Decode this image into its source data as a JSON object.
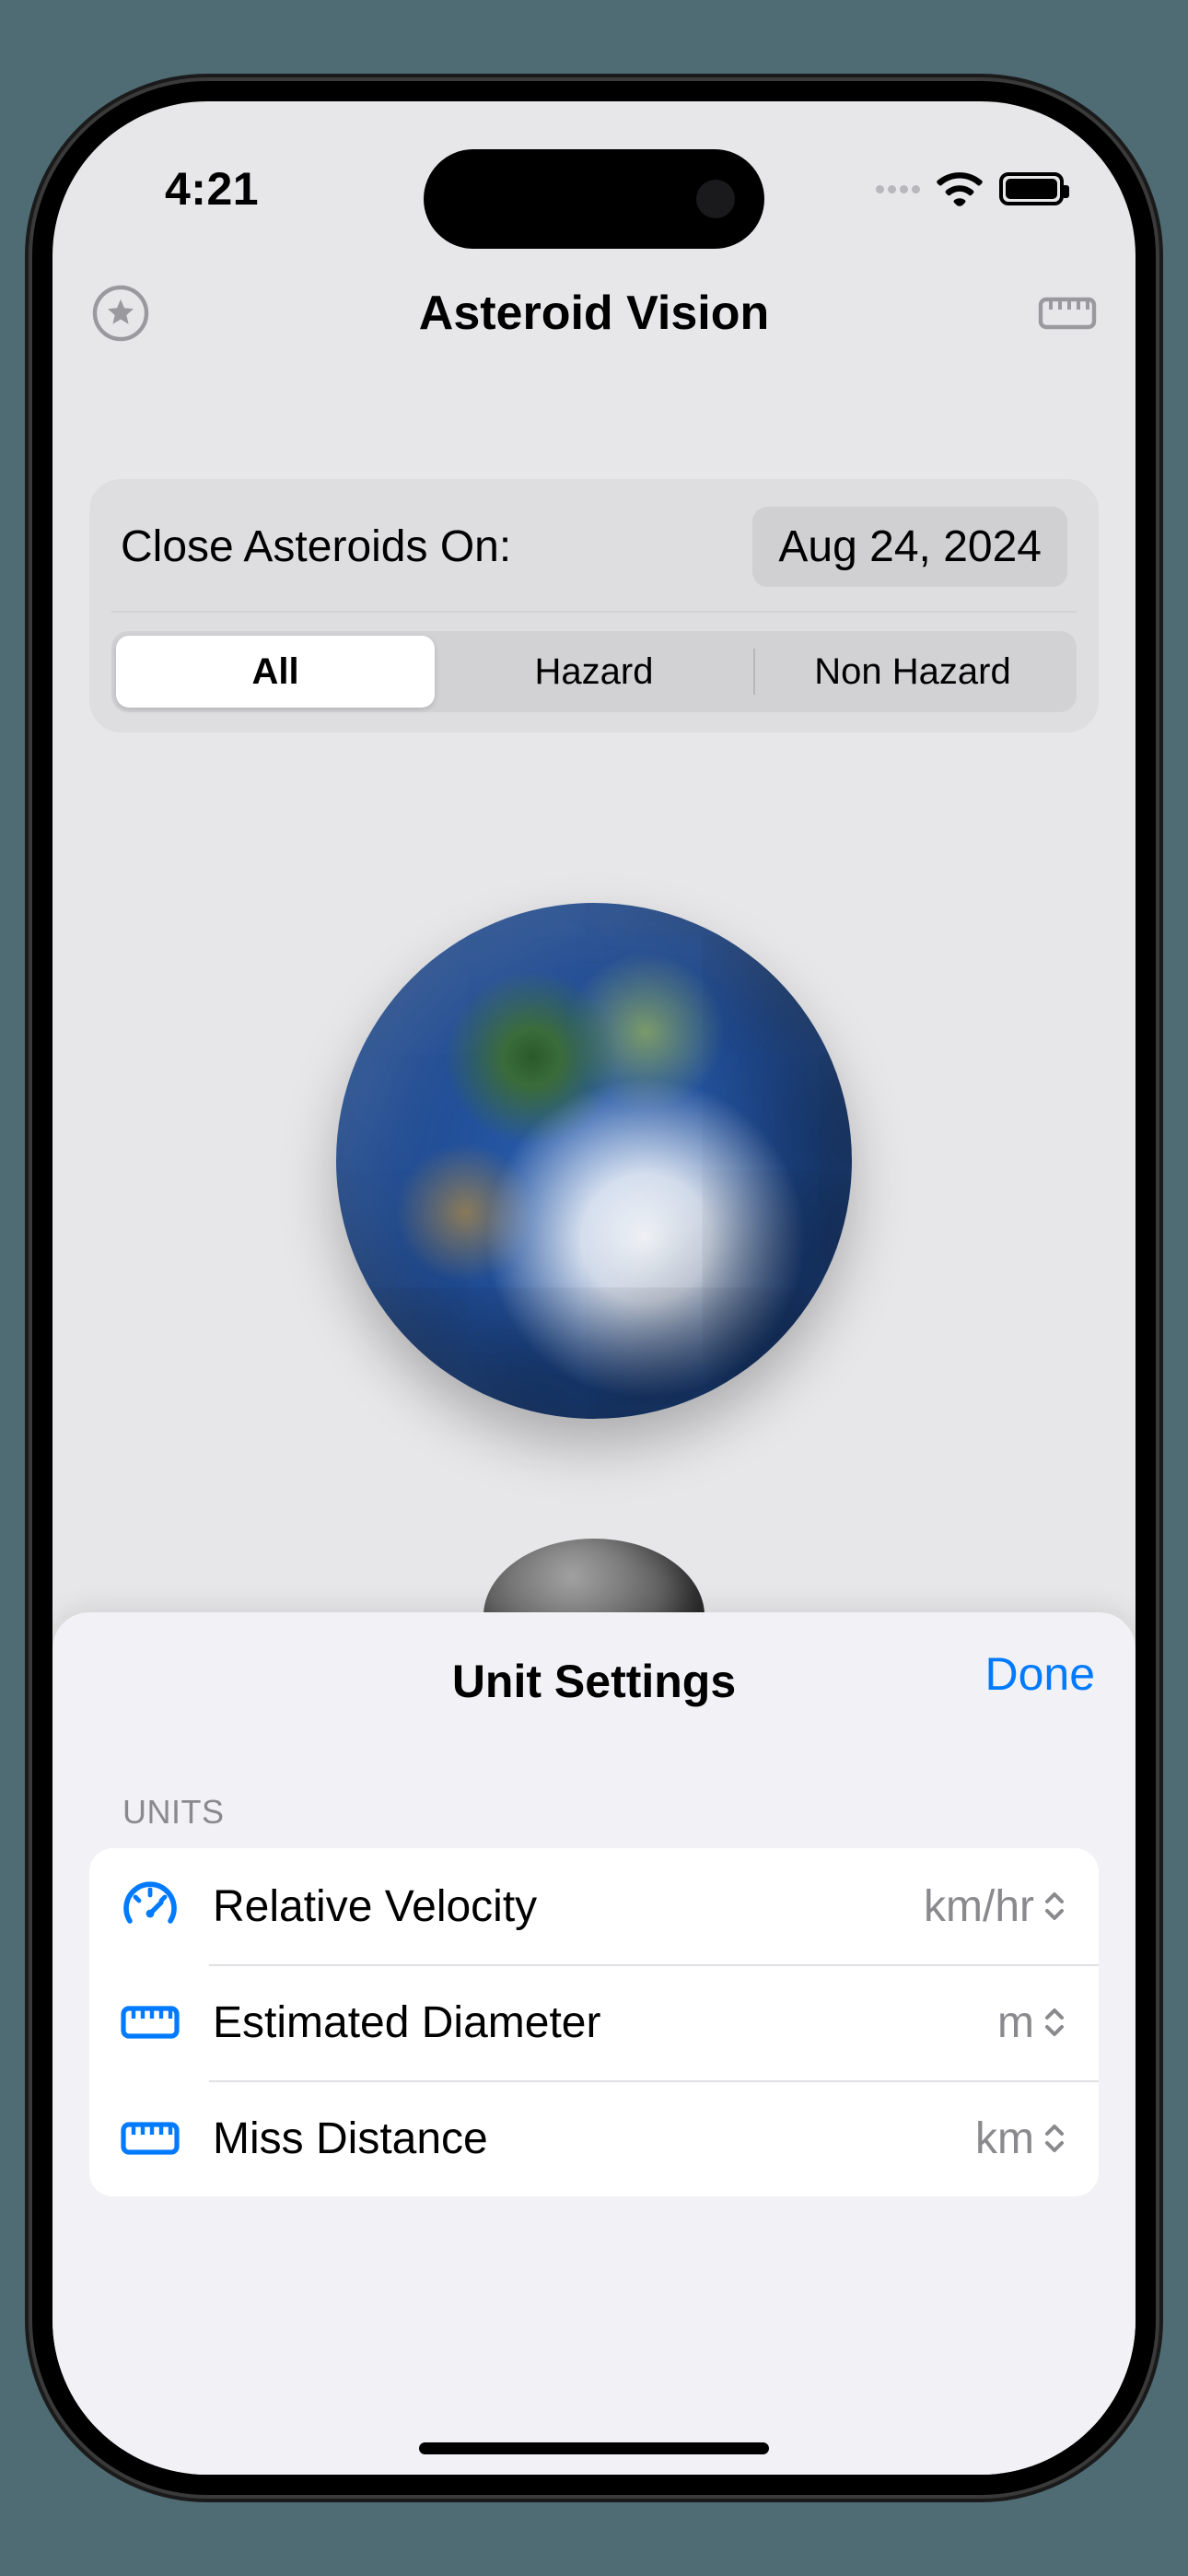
{
  "status": {
    "time": "4:21"
  },
  "nav": {
    "title": "Asteroid Vision"
  },
  "filter": {
    "label": "Close Asteroids On:",
    "date": "Aug 24, 2024",
    "segments": [
      "All",
      "Hazard",
      "Non Hazard"
    ],
    "selectedIndex": 0
  },
  "sheet": {
    "title": "Unit Settings",
    "done": "Done",
    "sectionLabel": "UNITS",
    "rows": [
      {
        "icon": "gauge",
        "label": "Relative Velocity",
        "value": "km/hr"
      },
      {
        "icon": "ruler",
        "label": "Estimated Diameter",
        "value": "m"
      },
      {
        "icon": "ruler",
        "label": "Miss Distance",
        "value": "km"
      }
    ]
  }
}
